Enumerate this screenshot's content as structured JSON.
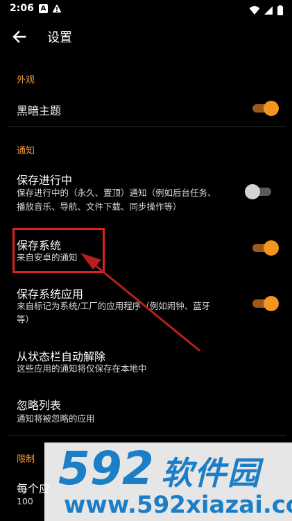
{
  "status_bar": {
    "time": "2:06",
    "a_icon_text": "A"
  },
  "toolbar": {
    "title": "设置"
  },
  "sections": {
    "appearance": "外观",
    "notifications": "通知",
    "limits": "限制"
  },
  "settings": {
    "dark_theme": {
      "title": "黑暗主题",
      "enabled": true
    },
    "ongoing": {
      "title": "保存进行中",
      "subtitle_line1": "保存进行中的（永久、置顶）通知（例如后台任务、",
      "subtitle_line2": "播放音乐、导航、文件下载、同步操作等）",
      "enabled": false
    },
    "system": {
      "title": "保存系统",
      "subtitle": "来自安卓的通知",
      "enabled": true
    },
    "system_apps": {
      "title": "保存系统应用",
      "subtitle_line1": "来自标记为系统/工厂的应用程序（例如闹钟、蓝牙",
      "subtitle_line2": "等）",
      "enabled": true
    },
    "auto_dismiss": {
      "title": "从状态栏自动解除",
      "subtitle": "这些应用的通知将仅保存在本地中"
    },
    "ignore_list": {
      "title": "忽略列表",
      "subtitle": "通知将被忽略的应用"
    },
    "per_app": {
      "title": "每个应",
      "value": "100"
    }
  },
  "watermark": {
    "logo_digits": "592",
    "logo_cn": "软件园",
    "url": "www.592xiazai.com"
  },
  "colors": {
    "accent": "#f39a3c",
    "toggle_on": "#f3961e",
    "highlight": "#e0221c",
    "watermark_blue": "#1c7ec7"
  }
}
